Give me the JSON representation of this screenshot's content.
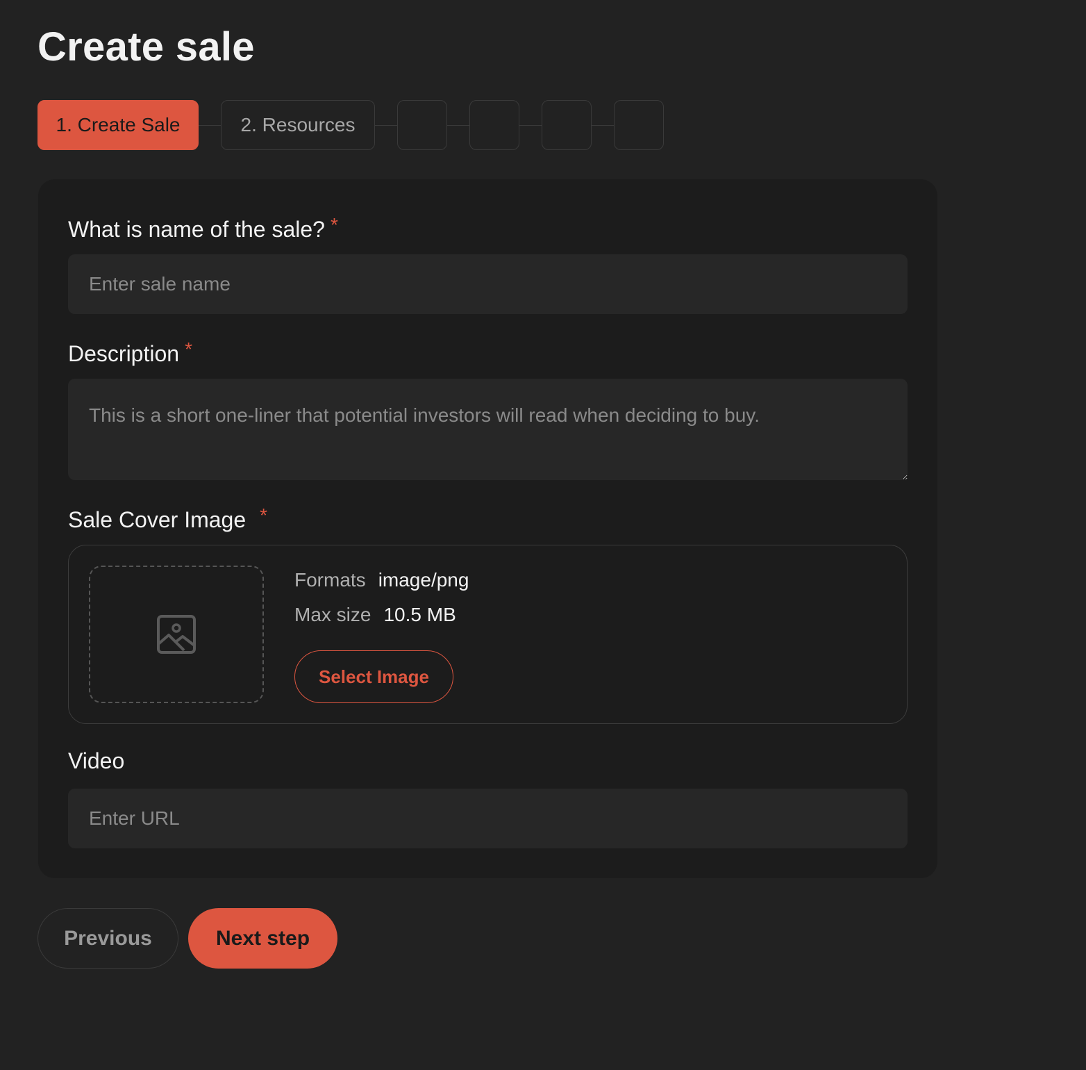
{
  "page": {
    "title": "Create sale"
  },
  "stepper": {
    "steps": [
      {
        "label": "1. Create Sale",
        "active": true
      },
      {
        "label": "2. Resources",
        "active": false
      },
      {
        "label": "",
        "active": false
      },
      {
        "label": "",
        "active": false
      },
      {
        "label": "",
        "active": false
      },
      {
        "label": "",
        "active": false
      }
    ]
  },
  "form": {
    "name": {
      "label": "What is name of the sale?",
      "required_mark": "*",
      "value": "",
      "placeholder": "Enter sale name"
    },
    "description": {
      "label": "Description",
      "required_mark": "*",
      "value": "",
      "placeholder": "This is a short one-liner that potential investors will read when deciding to buy."
    },
    "cover": {
      "label": "Sale Cover Image",
      "required_mark": "*",
      "formats_key": "Formats",
      "formats_value": "image/png",
      "max_size_key": "Max size",
      "max_size_value": "10.5 MB",
      "select_label": "Select Image",
      "icon": "image-icon"
    },
    "video": {
      "label": "Video",
      "value": "",
      "placeholder": "Enter URL"
    }
  },
  "footer": {
    "previous_label": "Previous",
    "next_label": "Next step"
  },
  "colors": {
    "accent": "#dd5640",
    "background": "#222222",
    "card": "#1c1c1c",
    "input": "#272727"
  }
}
